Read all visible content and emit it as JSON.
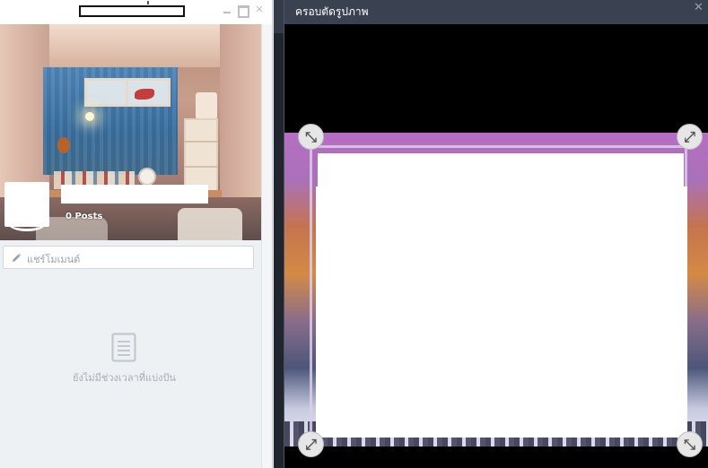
{
  "profile_window": {
    "cover_stats": {
      "posts_label": "0 Posts"
    },
    "composer": {
      "placeholder": "แชร์โมเมนต์"
    },
    "empty_state": {
      "message": "ยังไม่มีช่วงเวลาที่แบ่งปัน",
      "icon": "document-icon"
    },
    "window_controls": {
      "minimize_icon": "minimize-icon",
      "maximize_icon": "maximize-icon",
      "close_icon": "close-icon",
      "close_glyph": "✕"
    }
  },
  "crop_dialog": {
    "title": "ครอบตัดรูปภาพ",
    "close_glyph": "✕",
    "handles": {
      "top_left": "⤡",
      "top_right": "⤢",
      "bottom_left": "⤢",
      "bottom_right": "⤡"
    }
  },
  "colors": {
    "dialog_titlebar": "#3a4150",
    "panel_background": "#eef1f4",
    "crop_frame": "#ddcdeb"
  }
}
